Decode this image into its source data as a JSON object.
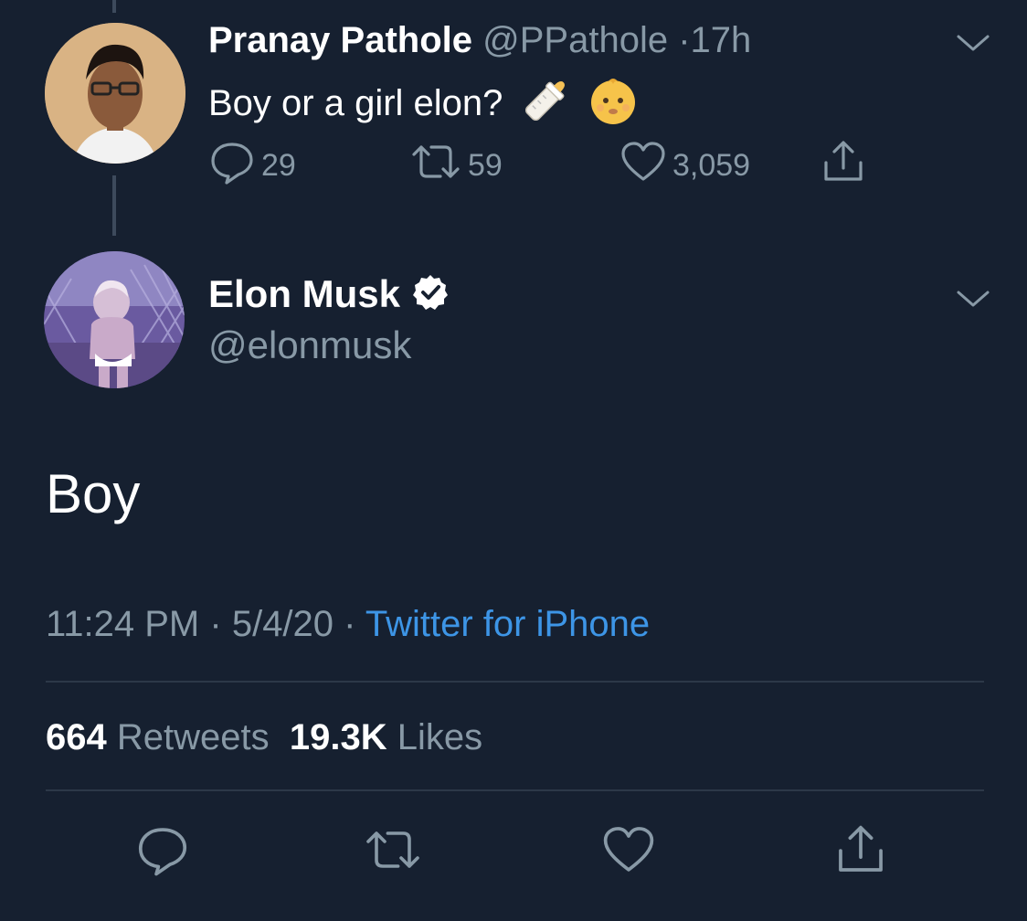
{
  "reply_tweet": {
    "author_name": "Pranay Pathole",
    "author_handle": "@PPathole",
    "separator": "·",
    "time_ago": "17h",
    "text": "Boy or a girl elon?",
    "emojis": [
      "baby-bottle-icon",
      "baby-face-icon"
    ],
    "stats": {
      "replies": "29",
      "retweets": "59",
      "likes": "3,059"
    }
  },
  "main_tweet": {
    "author_name": "Elon Musk",
    "author_handle": "@elonmusk",
    "verified": true,
    "text": "Boy",
    "time": "11:24 PM",
    "date": "5/4/20",
    "separator": "·",
    "source": "Twitter for iPhone",
    "retweet_count": "664",
    "retweet_label": "Retweets",
    "like_count": "19.3K",
    "like_label": "Likes"
  },
  "colors": {
    "background": "#162030",
    "text_primary": "#ffffff",
    "text_secondary": "#8899a6",
    "link": "#3d95e6",
    "divider": "#2c3848"
  }
}
